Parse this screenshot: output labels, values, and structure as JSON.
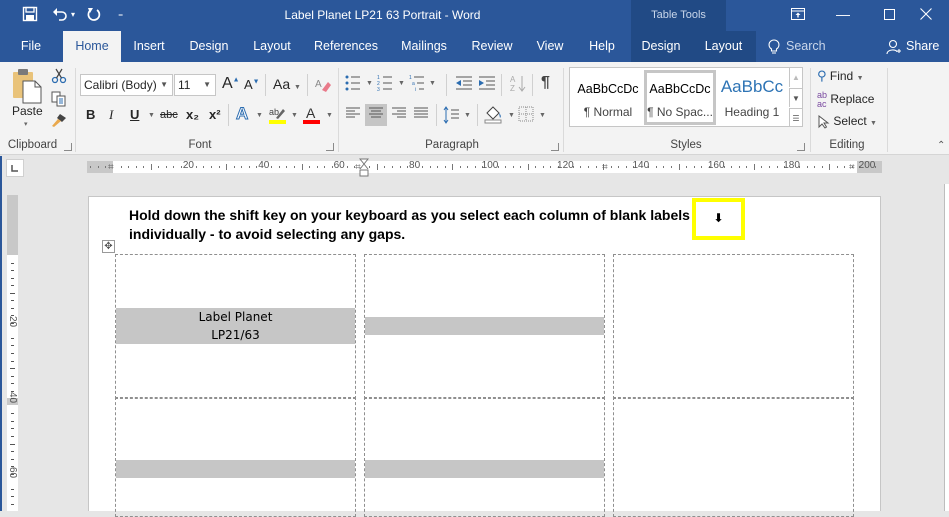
{
  "window": {
    "title": "Label Planet LP21 63 Portrait  -  Word",
    "context_tab_group": "Table Tools",
    "quick_access": {
      "save_icon": "save-icon",
      "undo_icon": "undo-icon",
      "redo_icon": "redo-icon",
      "customize_icon": "customize-qat-icon"
    },
    "controls": {
      "ribbon_display": "ribbon-display-options-icon",
      "minimize": "minimize-icon",
      "maximize": "maximize-icon",
      "close": "close-icon"
    }
  },
  "tabs": [
    {
      "label": "File"
    },
    {
      "label": "Home",
      "active": true
    },
    {
      "label": "Insert"
    },
    {
      "label": "Design"
    },
    {
      "label": "Layout"
    },
    {
      "label": "References"
    },
    {
      "label": "Mailings"
    },
    {
      "label": "Review"
    },
    {
      "label": "View"
    },
    {
      "label": "Help"
    },
    {
      "label": "Design",
      "contextual": true
    },
    {
      "label": "Layout",
      "contextual": true
    }
  ],
  "tell_me": {
    "label": "Search"
  },
  "share": {
    "label": "Share"
  },
  "ribbon": {
    "clipboard": {
      "label": "Clipboard",
      "paste": "Paste",
      "tools": [
        "cut",
        "copy",
        "format-painter"
      ]
    },
    "font": {
      "label": "Font",
      "font_name": "Calibri (Body)",
      "font_size": "11",
      "case_button": "Aa",
      "bold": "B",
      "italic": "I",
      "underline": "U",
      "strikethrough": "abc",
      "subscript": "x₂",
      "superscript": "x²",
      "highlight_color": "#ffff00",
      "font_color": "#ff0000"
    },
    "paragraph": {
      "label": "Paragraph",
      "active_alignment": "center"
    },
    "styles": {
      "label": "Styles",
      "items": [
        {
          "sample": "AaBbCcDc",
          "name": "¶ Normal"
        },
        {
          "sample": "AaBbCcDc",
          "name": "¶ No Spac...",
          "selected": true
        },
        {
          "sample": "AaBbCc",
          "name": "Heading 1"
        }
      ]
    },
    "editing": {
      "label": "Editing",
      "find": "Find",
      "replace": "Replace",
      "select": "Select"
    }
  },
  "ruler": {
    "horizontal_labels": [
      "20",
      "40",
      "60",
      "80",
      "100",
      "120",
      "140",
      "160",
      "180",
      "200"
    ],
    "vertical_labels": [
      "20",
      "40",
      "60"
    ]
  },
  "document": {
    "instruction": "Hold down the shift key on your keyboard as you select each column of blank labels individually - to avoid selecting any gaps.",
    "highlight_arrow": "⬇",
    "labels": [
      {
        "row": 1,
        "col": 1,
        "lines": [
          "Label Planet",
          "LP21/63"
        ],
        "shaded": true
      },
      {
        "row": 1,
        "col": 2,
        "lines": [],
        "shaded": true
      },
      {
        "row": 1,
        "col": 3,
        "lines": [],
        "shaded": false
      },
      {
        "row": 2,
        "col": 1,
        "lines": [],
        "shaded": true
      },
      {
        "row": 2,
        "col": 2,
        "lines": [],
        "shaded": true
      },
      {
        "row": 2,
        "col": 3,
        "lines": [],
        "shaded": false
      }
    ],
    "highlight_color": "#ffff00"
  }
}
